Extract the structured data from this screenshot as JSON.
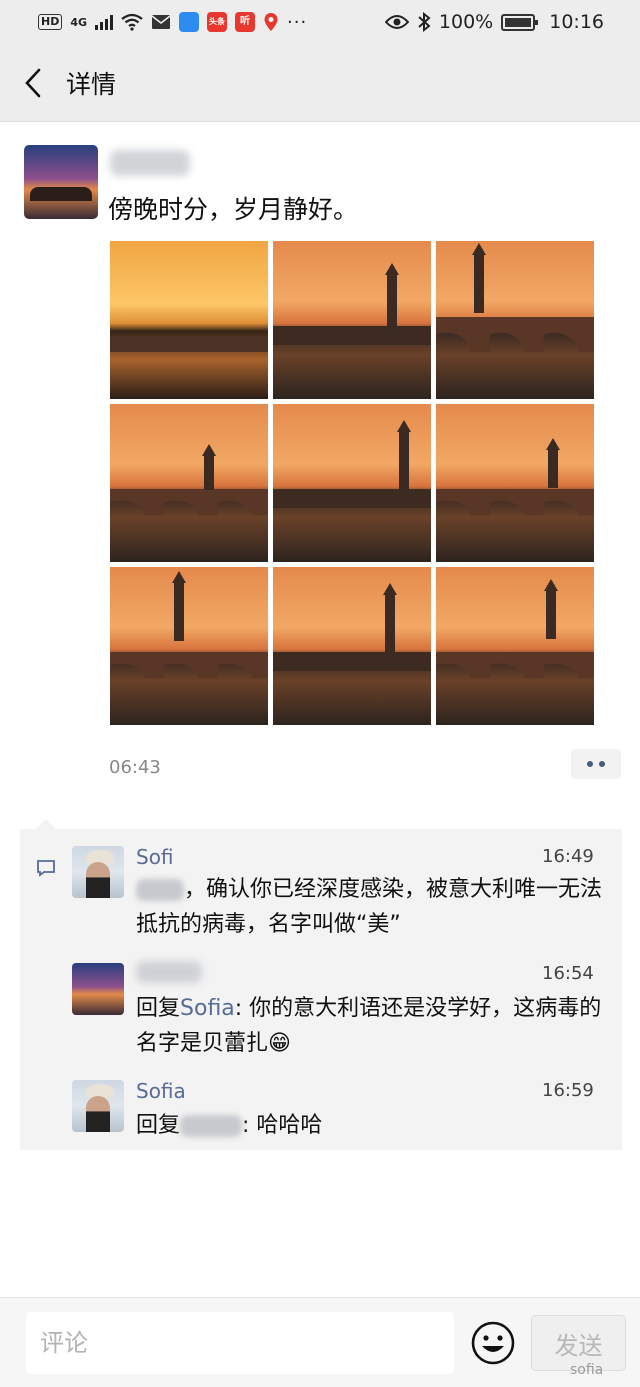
{
  "status_bar": {
    "hd": "HD",
    "network": "4G",
    "app_icon_news": "头条",
    "app_icon_listen": "听",
    "battery": "100%",
    "time": "10:16"
  },
  "nav": {
    "title": "详情"
  },
  "post": {
    "text": "傍晚时分，岁月静好。",
    "time": "06:43",
    "photo_count": 9
  },
  "comments": [
    {
      "name": "Sofi",
      "time": "16:49",
      "text": "，确认你已经深度感染，被意大利唯一无法抵抗的病毒，名字叫做“美”"
    },
    {
      "name": "",
      "time": "16:54",
      "reply_prefix": "回复",
      "reply_to": "Sofia",
      "text": ": 你的意大利语还是没学好，这病毒的名字是贝蕾扎😁"
    },
    {
      "name": "Sofia",
      "time": "16:59",
      "reply_prefix": "回复",
      "text": ": 哈哈哈"
    }
  ],
  "input": {
    "placeholder": "评论"
  },
  "send_label": "发送",
  "watermark": "sofia",
  "icons": [
    "back-arrow-icon",
    "eye-icon",
    "bluetooth-icon",
    "comment-icon",
    "emoji-icon",
    "more-dots-icon"
  ]
}
